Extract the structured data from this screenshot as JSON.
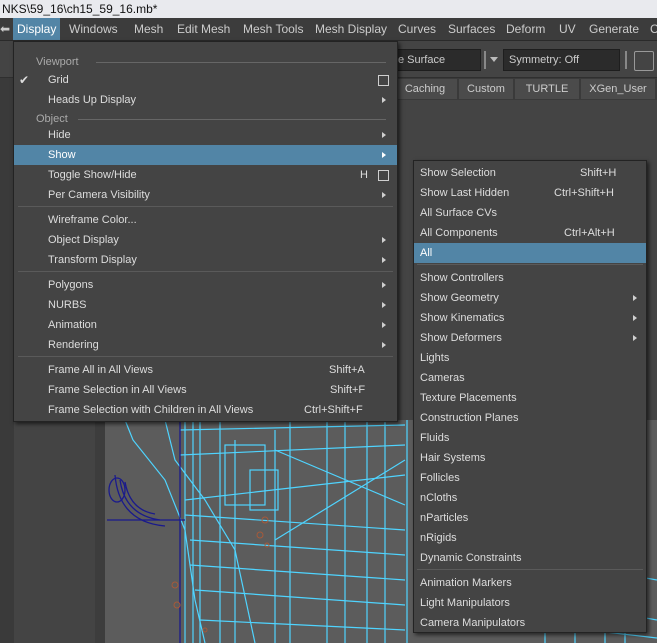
{
  "titlebar": {
    "title": "NKS\\59_16\\ch15_59_16.mb*"
  },
  "menubar": {
    "items": [
      "Display",
      "Windows",
      "Mesh",
      "Edit Mesh",
      "Mesh Tools",
      "Mesh Display",
      "Curves",
      "Surfaces",
      "Deform",
      "UV",
      "Generate",
      "C"
    ]
  },
  "statusbar": {
    "surface_field": "e Surface",
    "symmetry": "Symmetry: Off"
  },
  "shelf": {
    "tabs": [
      "Caching",
      "Custom",
      "TURTLE",
      "XGen_User"
    ]
  },
  "display_menu": {
    "viewport_section": "Viewport",
    "object_section": "Object",
    "items": [
      {
        "label": "Grid"
      },
      {
        "label": "Heads Up Display"
      },
      {
        "label": "Hide"
      },
      {
        "label": "Show"
      },
      {
        "label": "Toggle Show/Hide",
        "shortcut": "H"
      },
      {
        "label": "Per Camera Visibility"
      },
      {
        "label": "Wireframe Color..."
      },
      {
        "label": "Object Display"
      },
      {
        "label": "Transform Display"
      },
      {
        "label": "Polygons"
      },
      {
        "label": "NURBS"
      },
      {
        "label": "Animation"
      },
      {
        "label": "Rendering"
      },
      {
        "label": "Frame All in All Views",
        "shortcut": "Shift+A"
      },
      {
        "label": "Frame Selection in All Views",
        "shortcut": "Shift+F"
      },
      {
        "label": "Frame Selection with Children in All Views",
        "shortcut": "Ctrl+Shift+F"
      }
    ]
  },
  "show_submenu": {
    "items": [
      {
        "label": "Show Selection",
        "shortcut": "Shift+H"
      },
      {
        "label": "Show Last Hidden",
        "shortcut": "Ctrl+Shift+H"
      },
      {
        "label": "All Surface CVs"
      },
      {
        "label": "All Components",
        "shortcut": "Ctrl+Alt+H"
      },
      {
        "label": "All"
      },
      {
        "label": "Show Controllers"
      },
      {
        "label": "Show Geometry"
      },
      {
        "label": "Show Kinematics"
      },
      {
        "label": "Show Deformers"
      },
      {
        "label": "Lights"
      },
      {
        "label": "Cameras"
      },
      {
        "label": "Texture Placements"
      },
      {
        "label": "Construction Planes"
      },
      {
        "label": "Fluids"
      },
      {
        "label": "Hair Systems"
      },
      {
        "label": "Follicles"
      },
      {
        "label": "nCloths"
      },
      {
        "label": "nParticles"
      },
      {
        "label": "nRigids"
      },
      {
        "label": "Dynamic Constraints"
      },
      {
        "label": "Animation Markers"
      },
      {
        "label": "Light Manipulators"
      },
      {
        "label": "Camera Manipulators"
      }
    ]
  },
  "colors": {
    "highlight": "#5285a6",
    "wire": "#4fd4ff",
    "wire_dark": "#1a1a8c",
    "menu_bg": "#444444"
  }
}
